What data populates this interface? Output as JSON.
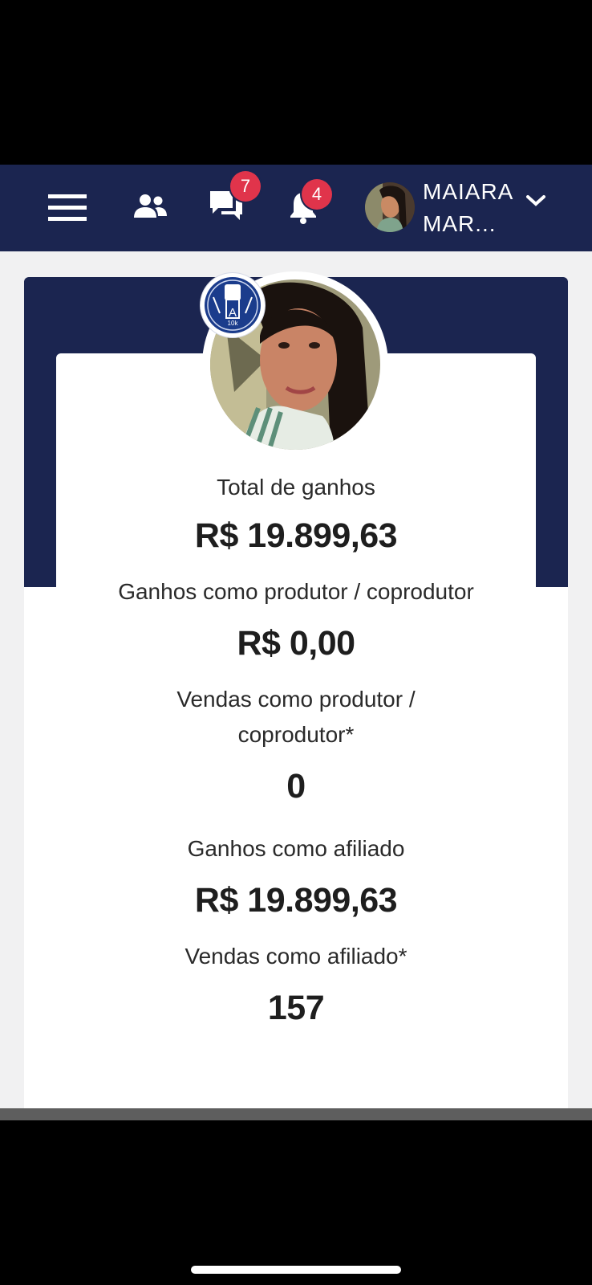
{
  "header": {
    "messages_badge": "7",
    "notifications_badge": "4",
    "user_name_line1": "MAIARA",
    "user_name_line2": "MAR..."
  },
  "stats": {
    "total_label": "Total de ganhos",
    "total_value": "R$ 19.899,63",
    "producer_earnings_label": "Ganhos como produtor / coprodutor",
    "producer_earnings_value": "R$ 0,00",
    "producer_sales_label_line1": "Vendas como produtor /",
    "producer_sales_label_line2": "coprodutor*",
    "producer_sales_value": "0",
    "affiliate_earnings_label": "Ganhos como afiliado",
    "affiliate_earnings_value": "R$ 19.899,63",
    "affiliate_sales_label": "Vendas como afiliado*",
    "affiliate_sales_value": "157"
  },
  "badge_text": {
    "letter": "A",
    "level": "10k"
  },
  "colors": {
    "navy": "#1b2550",
    "badge_red": "#e0344b",
    "background": "#f1f1f2"
  },
  "icons": [
    "hamburger-menu-icon",
    "users-icon",
    "chat-icon",
    "bell-icon",
    "chevron-down-icon"
  ]
}
